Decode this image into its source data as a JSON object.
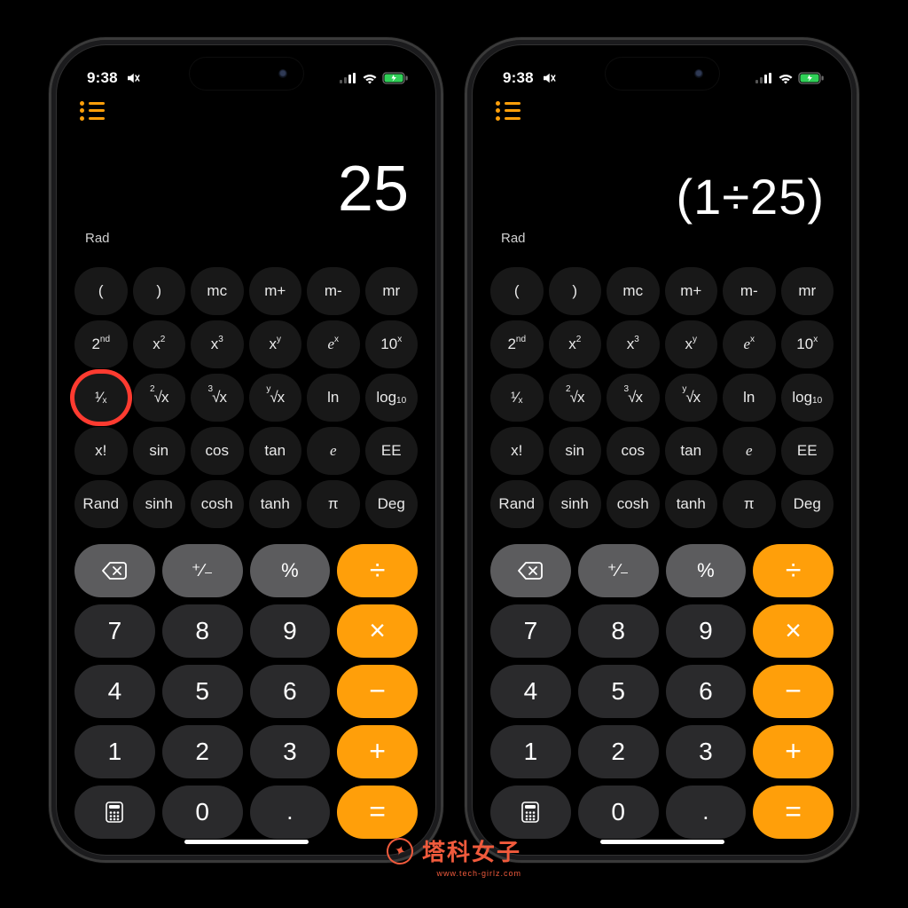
{
  "status": {
    "time": "9:38"
  },
  "phones": {
    "left": {
      "display": "25",
      "display_size": "big",
      "mode": "Rad",
      "highlight_reciprocal": true
    },
    "right": {
      "display": "(1÷25)",
      "display_size": "medium",
      "mode": "Rad",
      "highlight_reciprocal": false
    }
  },
  "sci_rows": [
    [
      {
        "name": "paren-open",
        "label": "("
      },
      {
        "name": "paren-close",
        "label": ")"
      },
      {
        "name": "mem-clear",
        "label": "mc"
      },
      {
        "name": "mem-plus",
        "label": "m+"
      },
      {
        "name": "mem-minus",
        "label": "m-"
      },
      {
        "name": "mem-recall",
        "label": "mr"
      }
    ],
    [
      {
        "name": "second-func",
        "html": "2<sup>nd</sup>"
      },
      {
        "name": "x-squared",
        "html": "x<sup>2</sup>"
      },
      {
        "name": "x-cubed",
        "html": "x<sup>3</sup>"
      },
      {
        "name": "x-power-y",
        "html": "x<sup>y</sup>"
      },
      {
        "name": "e-power-x",
        "html": "<span class='ital'>e</span><sup>x</sup>"
      },
      {
        "name": "ten-power-x",
        "html": "10<sup>x</sup>"
      }
    ],
    [
      {
        "name": "reciprocal",
        "html": "¹⁄<sub>x</sub>",
        "reciprocal": true
      },
      {
        "name": "sqrt",
        "html": "<span class='root'><sup>2</sup>√x</span>"
      },
      {
        "name": "cbrt",
        "html": "<span class='root'><sup>3</sup>√x</span>"
      },
      {
        "name": "y-root",
        "html": "<span class='root'><sup>y</sup>√x</span>"
      },
      {
        "name": "ln",
        "label": "ln"
      },
      {
        "name": "log10",
        "html": "log<sub>10</sub>"
      }
    ],
    [
      {
        "name": "factorial",
        "label": "x!"
      },
      {
        "name": "sin",
        "label": "sin"
      },
      {
        "name": "cos",
        "label": "cos"
      },
      {
        "name": "tan",
        "label": "tan"
      },
      {
        "name": "euler-e",
        "html": "<span class='ital'>e</span>"
      },
      {
        "name": "ee",
        "label": "EE"
      }
    ],
    [
      {
        "name": "rand",
        "label": "Rand"
      },
      {
        "name": "sinh",
        "label": "sinh"
      },
      {
        "name": "cosh",
        "label": "cosh"
      },
      {
        "name": "tanh",
        "label": "tanh"
      },
      {
        "name": "pi",
        "label": "π"
      },
      {
        "name": "deg",
        "label": "Deg"
      }
    ]
  ],
  "basic": {
    "backspace_name": "backspace",
    "plusminus": "⁺∕₋",
    "percent": "%",
    "divide": "÷",
    "digits": [
      "7",
      "8",
      "9",
      "4",
      "5",
      "6",
      "1",
      "2",
      "3",
      "0"
    ],
    "multiply": "×",
    "minus": "−",
    "plus": "+",
    "equals": "=",
    "decimal": ".",
    "mode_switch_name": "basic-mode"
  },
  "watermark": {
    "name": "塔科女子",
    "sub": "www.tech-girlz.com"
  }
}
